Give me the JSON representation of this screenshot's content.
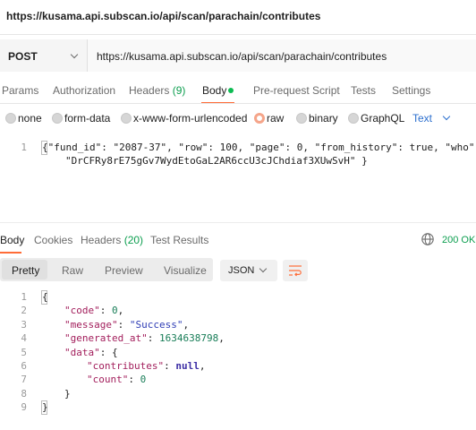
{
  "window": {
    "title_url": "https://kusama.api.subscan.io/api/scan/parachain/contributes"
  },
  "request": {
    "method": "POST",
    "url": "https://kusama.api.subscan.io/api/scan/parachain/contributes",
    "tabs": [
      {
        "label": "Params"
      },
      {
        "label": "Authorization"
      },
      {
        "label": "Headers",
        "count": "(9)"
      },
      {
        "label": "Body"
      },
      {
        "label": "Pre-request Script"
      },
      {
        "label": "Tests"
      },
      {
        "label": "Settings"
      }
    ],
    "body_types": [
      "none",
      "form-data",
      "x-www-form-urlencoded",
      "raw",
      "binary",
      "GraphQL"
    ],
    "raw_format": "Text",
    "body_line_number": "1",
    "body_line_1": "{\"fund_id\": \"2087-37\", \"row\": 100, \"page\": 0, \"from_history\": true, \"who\": ",
    "body_line_2": "\"DrCFRy8rE75gGv7WydEtoGaL2AR6ccU3cJChdiaf3XUwSvH\" }"
  },
  "response": {
    "tabs": [
      {
        "label": "Body"
      },
      {
        "label": "Cookies"
      },
      {
        "label": "Headers",
        "count": "(20)"
      },
      {
        "label": "Test Results"
      }
    ],
    "status": "200 OK",
    "view_modes": [
      "Pretty",
      "Raw",
      "Preview",
      "Visualize"
    ],
    "format": "JSON",
    "line_numbers": [
      "1",
      "2",
      "3",
      "4",
      "5",
      "6",
      "7",
      "8",
      "9"
    ],
    "lines": {
      "l1": "{",
      "l2_key": "\"code\"",
      "l2_val": "0",
      "l3_key": "\"message\"",
      "l3_val": "\"Success\"",
      "l4_key": "\"generated_at\"",
      "l4_val": "1634638798",
      "l5_key": "\"data\"",
      "l5_brace": "{",
      "l6_key": "\"contributes\"",
      "l6_val": "null",
      "l7_key": "\"count\"",
      "l7_val": "0",
      "l8": "}",
      "l9": "}"
    }
  }
}
